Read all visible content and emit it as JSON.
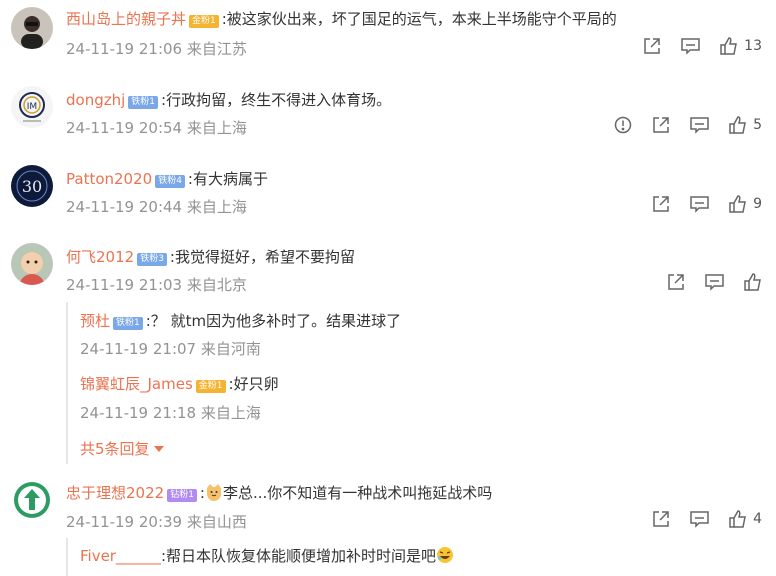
{
  "comments": [
    {
      "user": "西山岛上的親子丼",
      "badge": "金粉1",
      "text": ":被这家伙出来，坏了国足的运气，本来上半场能守个平局的",
      "time": "24-11-19 21:06",
      "loc": "来自江苏",
      "likes": "13"
    },
    {
      "user": "dongzhj",
      "badge": "铁粉1",
      "text": ":行政拘留，终生不得进入体育场。",
      "time": "24-11-19 20:54",
      "loc": "来自上海",
      "likes": "5"
    },
    {
      "user": "Patton2020",
      "badge": "铁粉4",
      "text": ":有大病属于",
      "time": "24-11-19 20:44",
      "loc": "来自上海",
      "likes": "9"
    },
    {
      "user": "何飞2012",
      "badge": "铁粉3",
      "text": ":我觉得挺好，希望不要拘留",
      "time": "24-11-19 21:03",
      "loc": "来自北京",
      "likes": "",
      "replies": [
        {
          "user": "预杜",
          "badge": "铁粉1",
          "text": ":？ 就tm因为他多补时了。结果进球了",
          "time": "24-11-19 21:07",
          "loc": "来自河南"
        },
        {
          "user": "锦翼虹辰_James",
          "badge": "金粉1",
          "text": ":好只卵",
          "time": "24-11-19 21:18",
          "loc": "来自上海"
        }
      ],
      "more_replies": "共5条回复"
    },
    {
      "user": "忠于理想2022",
      "badge": "钻粉1",
      "text": "李总...你不知道有一种战术叫拖延战术吗",
      "time": "24-11-19 20:39",
      "loc": "来自山西",
      "likes": "4",
      "replies": [
        {
          "user": "Fiver______",
          "text": ":帮日本队恢复体能顺便增加补时时间是吧"
        }
      ]
    }
  ],
  "icons": {
    "share": "share-icon",
    "comment": "comment-icon",
    "like": "thumbs-up-icon",
    "report": "report-icon"
  },
  "colors": {
    "username": "#eb7350",
    "meta": "#939393",
    "gold_badge": "#f4b330",
    "iron_badge": "#7aa7e8",
    "drill_badge": "#b28bf0"
  }
}
